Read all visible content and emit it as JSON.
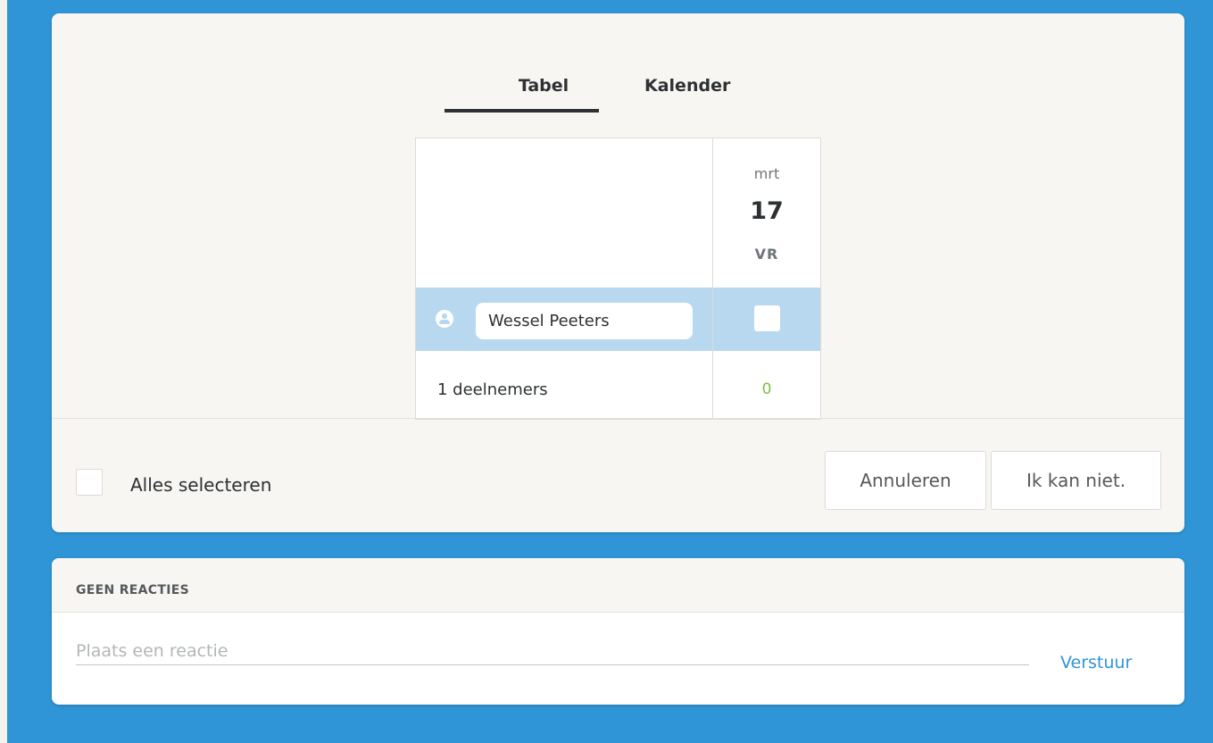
{
  "tabs": {
    "tabel": "Tabel",
    "kalender": "Kalender"
  },
  "poll": {
    "date": {
      "month": "mrt",
      "day": "17",
      "weekday": "VR"
    },
    "participant": {
      "name": "Wessel Peeters",
      "checked": false
    },
    "participants_label": "1 deelnemers",
    "yes_count": "0"
  },
  "footer": {
    "select_all_label": "Alles selecteren",
    "cancel_label": "Annuleren",
    "decline_label": "Ik kan niet."
  },
  "comments": {
    "title": "GEEN REACTIES",
    "placeholder": "Plaats een reactie",
    "send_label": "Verstuur"
  },
  "colors": {
    "background": "#2f95d6",
    "selected_row": "#b8d8ef",
    "count_green": "#7fbf3f",
    "link_blue": "#2f95d6"
  },
  "icons": {
    "user": "user-circle-icon"
  }
}
